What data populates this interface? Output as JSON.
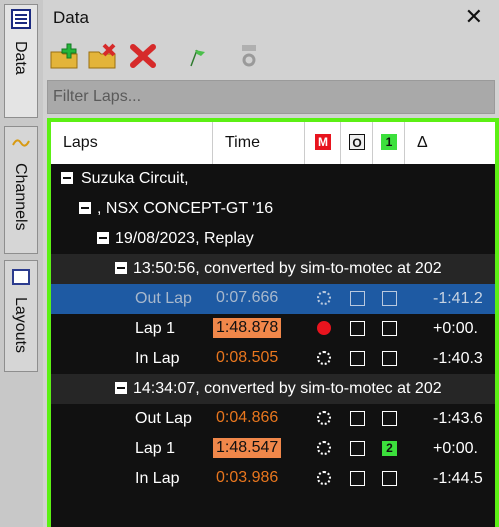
{
  "sidebar": {
    "tabs": [
      {
        "label": "Data",
        "icon": "list-icon",
        "active": true
      },
      {
        "label": "Channels",
        "icon": "wave-icon",
        "active": false
      },
      {
        "label": "Layouts",
        "icon": "layout-icon",
        "active": false
      }
    ]
  },
  "panel": {
    "title": "Data",
    "close_glyph": "✕",
    "toolbar": {
      "buttons": [
        "open-folder-add-icon",
        "open-folder-remove-icon",
        "delete-icon",
        "flag-icon",
        "settings-icon"
      ]
    },
    "filter": {
      "placeholder": "Filter Laps...",
      "value": ""
    },
    "columns": {
      "laps": "Laps",
      "time": "Time",
      "ref_icon": "M",
      "overlay_icon": "O",
      "compare_icon": "1",
      "delta": "Δ"
    },
    "tree": {
      "circuit": "Suzuka Circuit,",
      "car": ", NSX CONCEPT-GT '16",
      "session": "19/08/2023, Replay",
      "runs": [
        {
          "label": "13:50:56, converted by sim-to-motec at 202",
          "laps": [
            {
              "name": "Out Lap",
              "time": "0:07.666",
              "delta": "-1:41.2",
              "best": false,
              "selected": true,
              "radio": false,
              "mark2": ""
            },
            {
              "name": "Lap 1",
              "time": "1:48.878",
              "delta": "+0:00.",
              "best": true,
              "selected": false,
              "radio": true,
              "mark2": ""
            },
            {
              "name": "In Lap",
              "time": "0:08.505",
              "delta": "-1:40.3",
              "best": false,
              "selected": false,
              "radio": false,
              "mark2": ""
            }
          ]
        },
        {
          "label": "14:34:07, converted by sim-to-motec at 202",
          "laps": [
            {
              "name": "Out Lap",
              "time": "0:04.866",
              "delta": "-1:43.6",
              "best": false,
              "selected": false,
              "radio": false,
              "mark2": ""
            },
            {
              "name": "Lap 1",
              "time": "1:48.547",
              "delta": "+0:00.",
              "best": true,
              "selected": false,
              "radio": false,
              "mark2": "2"
            },
            {
              "name": "In Lap",
              "time": "0:03.986",
              "delta": "-1:44.5",
              "best": false,
              "selected": false,
              "radio": false,
              "mark2": ""
            }
          ]
        }
      ]
    }
  },
  "colors": {
    "accent_border": "#5cf014",
    "lap_time": "#e8761e",
    "best_lap_bg": "#f0874a",
    "selected_row": "#1e5aa3",
    "radio_active": "#e8141e"
  }
}
